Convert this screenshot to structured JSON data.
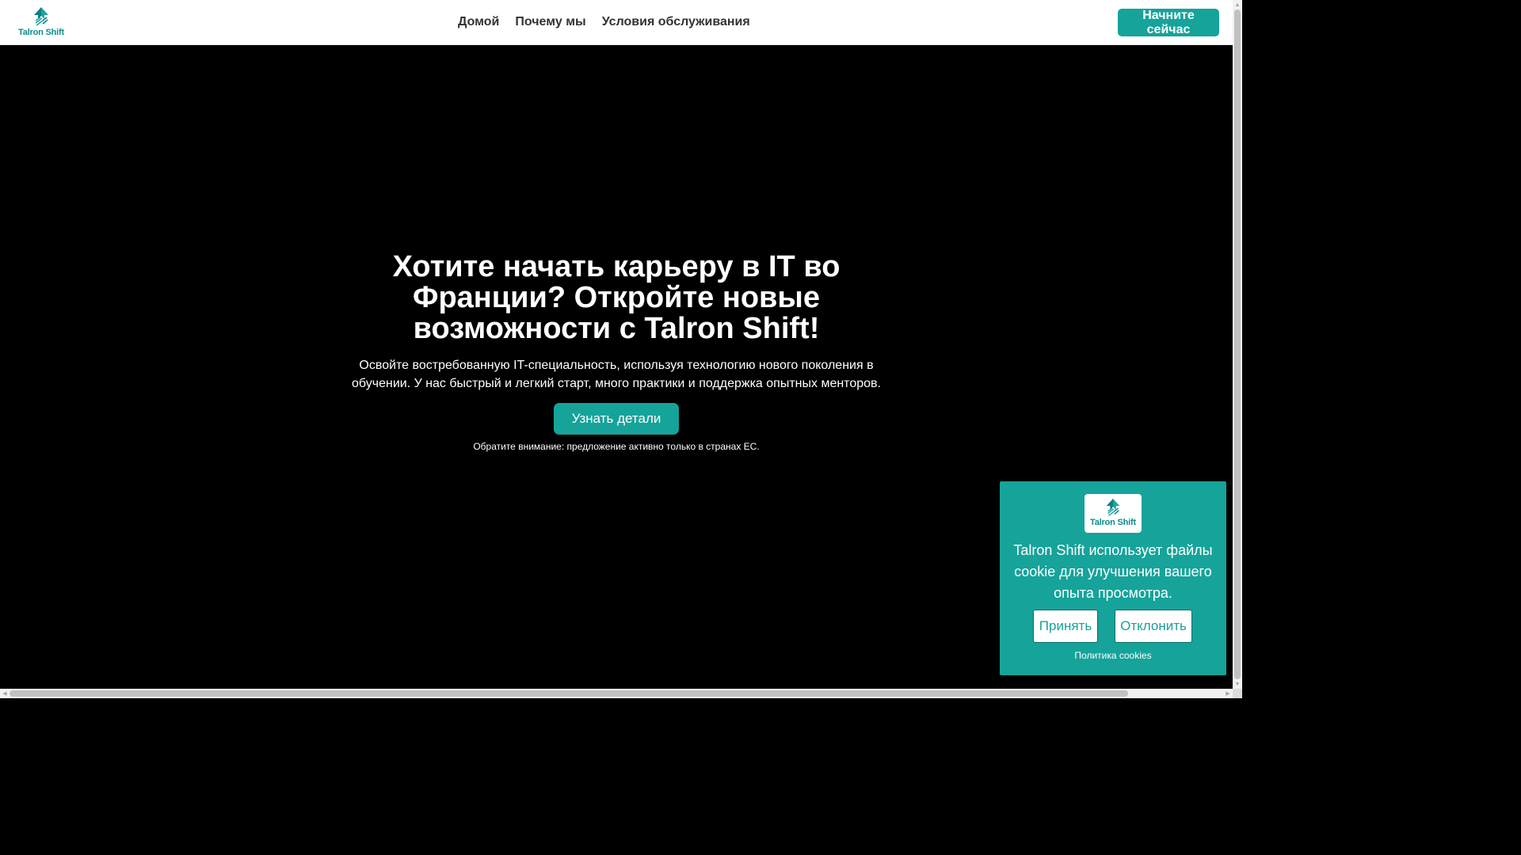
{
  "brand": {
    "name": "Talron Shift",
    "color": "#16a39a",
    "logo_icon": "arrow-up-icon"
  },
  "nav": {
    "items": [
      {
        "label": "Домой"
      },
      {
        "label": "Почему мы"
      },
      {
        "label": "Условия обслуживания"
      }
    ],
    "cta_label": "Начните сейчас"
  },
  "hero": {
    "title": "Хотите начать карьеру в IT во Франции? Откройте новые возможности с Talron Shift!",
    "subtitle": "Освойте востребованную IT-специальность, используя технологию нового поколения в обучении. У нас быстрый и легкий старт, много практики и поддержка опытных менторов.",
    "button_label": "Узнать детали",
    "note": "Обратите внимание: предложение активно только в странах ЕС."
  },
  "cookie": {
    "text": "Talron Shift использует файлы cookie для улучшения вашего опыта просмотра.",
    "accept_label": "Принять",
    "decline_label": "Отклонить",
    "policy_label": "Политика cookies"
  }
}
